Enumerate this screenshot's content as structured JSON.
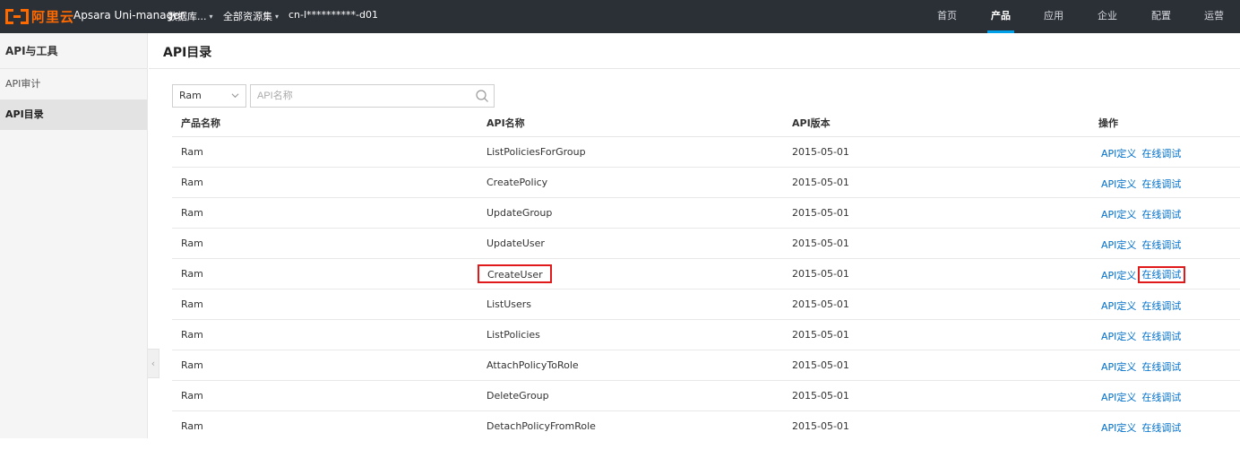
{
  "topbar": {
    "logo_text": "阿里云",
    "app_name": "Apsara Uni-manager",
    "menu_database": "数据库...",
    "menu_resource_set": "全部资源集",
    "region": "cn-l**********-d01",
    "nav": [
      "首页",
      "产品",
      "应用",
      "企业",
      "配置",
      "运营"
    ],
    "nav_active": "产品",
    "accent_color": "#ff6a00",
    "active_indicator_color": "#00a1e8"
  },
  "sidebar": {
    "title": "API与工具",
    "items": [
      {
        "label": "API审计",
        "active": false
      },
      {
        "label": "API目录",
        "active": true
      }
    ]
  },
  "main": {
    "title": "API目录",
    "filter": {
      "select_value": "Ram",
      "search_placeholder": "API名称"
    },
    "table": {
      "columns": [
        "产品名称",
        "API名称",
        "API版本",
        "操作"
      ],
      "op_define": "API定义",
      "op_debug": "在线调试",
      "rows": [
        {
          "product": "Ram",
          "api": "ListPoliciesForGroup",
          "version": "2015-05-01"
        },
        {
          "product": "Ram",
          "api": "CreatePolicy",
          "version": "2015-05-01"
        },
        {
          "product": "Ram",
          "api": "UpdateGroup",
          "version": "2015-05-01"
        },
        {
          "product": "Ram",
          "api": "UpdateUser",
          "version": "2015-05-01"
        },
        {
          "product": "Ram",
          "api": "CreateUser",
          "version": "2015-05-01",
          "highlighted": true
        },
        {
          "product": "Ram",
          "api": "ListUsers",
          "version": "2015-05-01"
        },
        {
          "product": "Ram",
          "api": "ListPolicies",
          "version": "2015-05-01"
        },
        {
          "product": "Ram",
          "api": "AttachPolicyToRole",
          "version": "2015-05-01"
        },
        {
          "product": "Ram",
          "api": "DeleteGroup",
          "version": "2015-05-01"
        },
        {
          "product": "Ram",
          "api": "DetachPolicyFromRole",
          "version": "2015-05-01"
        }
      ],
      "link_color": "#0070cc",
      "highlight_color": "#e0191b"
    }
  }
}
